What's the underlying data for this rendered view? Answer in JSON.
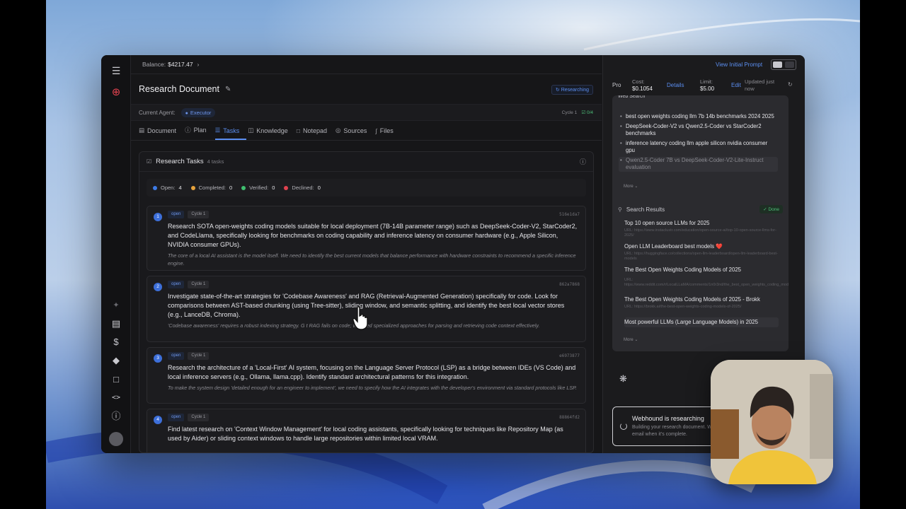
{
  "topbar": {
    "balance_label": "Balance:",
    "balance_value": "$4217.47",
    "initial_prompt_link": "View Initial Prompt"
  },
  "document": {
    "title": "Research Document",
    "status": "Researching",
    "agent_label": "Current Agent:",
    "agent_name": "Executor",
    "cycle": "Cycle 1",
    "progress": "0/4"
  },
  "tabs": [
    {
      "label": "Document",
      "icon": "document-icon"
    },
    {
      "label": "Plan",
      "icon": "plan-icon"
    },
    {
      "label": "Tasks",
      "icon": "tasks-icon",
      "active": true
    },
    {
      "label": "Knowledge",
      "icon": "knowledge-icon"
    },
    {
      "label": "Notepad",
      "icon": "notepad-icon"
    },
    {
      "label": "Sources",
      "icon": "globe-icon"
    },
    {
      "label": "Files",
      "icon": "paperclip-icon"
    }
  ],
  "tasks_panel": {
    "title": "Research Tasks",
    "count": "4 tasks",
    "counts": [
      {
        "label": "Open:",
        "value": "4",
        "color": "#3d7be6"
      },
      {
        "label": "Completed:",
        "value": "0",
        "color": "#e6a23c"
      },
      {
        "label": "Verified:",
        "value": "0",
        "color": "#3fbf6f"
      },
      {
        "label": "Declined:",
        "value": "0",
        "color": "#e0424f"
      }
    ],
    "tasks": [
      {
        "num": "1",
        "status": "open",
        "cycle": "Cycle 1",
        "hash": "516e1da7",
        "desc": "Research SOTA open-weights coding models suitable for local deployment (7B-14B parameter range) such as DeepSeek-Coder-V2, StarCoder2, and CodeLlama, specifically looking for benchmarks on coding capability and inference latency on consumer hardware (e.g., Apple Silicon, NVIDIA consumer GPUs).",
        "note": "The core of a local AI assistant is the model itself. We need to identify the best current models that balance performance with hardware constraints to recommend a specific inference engine."
      },
      {
        "num": "2",
        "status": "open",
        "cycle": "Cycle 1",
        "hash": "862a7868",
        "desc": "Investigate state-of-the-art strategies for 'Codebase Awareness' and RAG (Retrieval-Augmented Generation) specifically for code. Look for comparisons between AST-based chunking (using Tree-sitter), sliding window, and semantic splitting, and identify the best local vector stores (e.g., LanceDB, Chroma).",
        "note": "'Codebase awareness' requires a robust indexing strategy. G        t RAG fails on code; we need specialized approaches for parsing and retrieving code context effectively."
      },
      {
        "num": "3",
        "status": "open",
        "cycle": "Cycle 1",
        "hash": "e6973877",
        "desc": "Research the architecture of a 'Local-First' AI system, focusing on the Language Server Protocol (LSP) as a bridge between IDEs (VS Code) and local inference servers (e.g., Ollama, llama.cpp). Identify standard architectural patterns for this integration.",
        "note": "To make the system design 'detailed enough for an engineer to implement', we need to specify how the AI integrates with the developer's environment via standard protocols like LSP."
      },
      {
        "num": "4",
        "status": "open",
        "cycle": "Cycle 1",
        "hash": "88864fd2",
        "desc": "Find latest research on 'Context Window Management' for local coding assistants, specifically looking for techniques like Repository Map (as used by Aider) or sliding context windows to handle large repositories within limited local VRAM.",
        "note": ""
      }
    ]
  },
  "right_panel": {
    "plan": "Pro",
    "cost_label": "Cost:",
    "cost_value": "$0.1054",
    "details_link": "Details",
    "limit_label": "Limit:",
    "limit_value": "$5.00",
    "edit_link": "Edit",
    "updated": "Updated just now",
    "queries": [
      "best open weights coding llm 7b 14b benchmarks 2024 2025",
      "DeepSeek-Coder-V2 vs Qwen2.5-Coder vs StarCoder2 benchmarks",
      "inference latency coding llm apple silicon nvidia consumer gpu",
      "Qwen2.5-Coder 7B vs DeepSeek-Coder-V2-Lite-Instruct evaluation"
    ],
    "more_label": "More",
    "search_results_label": "Search Results",
    "done_label": "Done",
    "results": [
      {
        "title": "Top 10 open source LLMs for 2025",
        "url": "URL: https://www.instaclustr.com/education/open-source-ai/top-10-open-source-llms-for-2025/"
      },
      {
        "title": "Open LLM Leaderboard best models ❤️",
        "url": "URL: https://huggingface.co/collections/open-llm-leaderboard/open-llm-leaderboard-best-models"
      },
      {
        "title": "The Best Open Weights Coding Models of 2025",
        "url": "URL: https://www.reddit.com/r/LocalLLaMA/comments/1n0r3nd/the_best_open_weights_coding_models_of_2025/"
      },
      {
        "title": "The Best Open Weights Coding Models of 2025 - Brokk",
        "url": "URL: https://brokk.ai/the-best-open-weights-coding-models-of-2025/"
      },
      {
        "title": "Most powerful LLMs (Large Language Models) in 2025",
        "url": ""
      }
    ],
    "webhound_title": "Webhound is researching",
    "webhound_sub": "Building your research document. We'll email when it's complete."
  }
}
